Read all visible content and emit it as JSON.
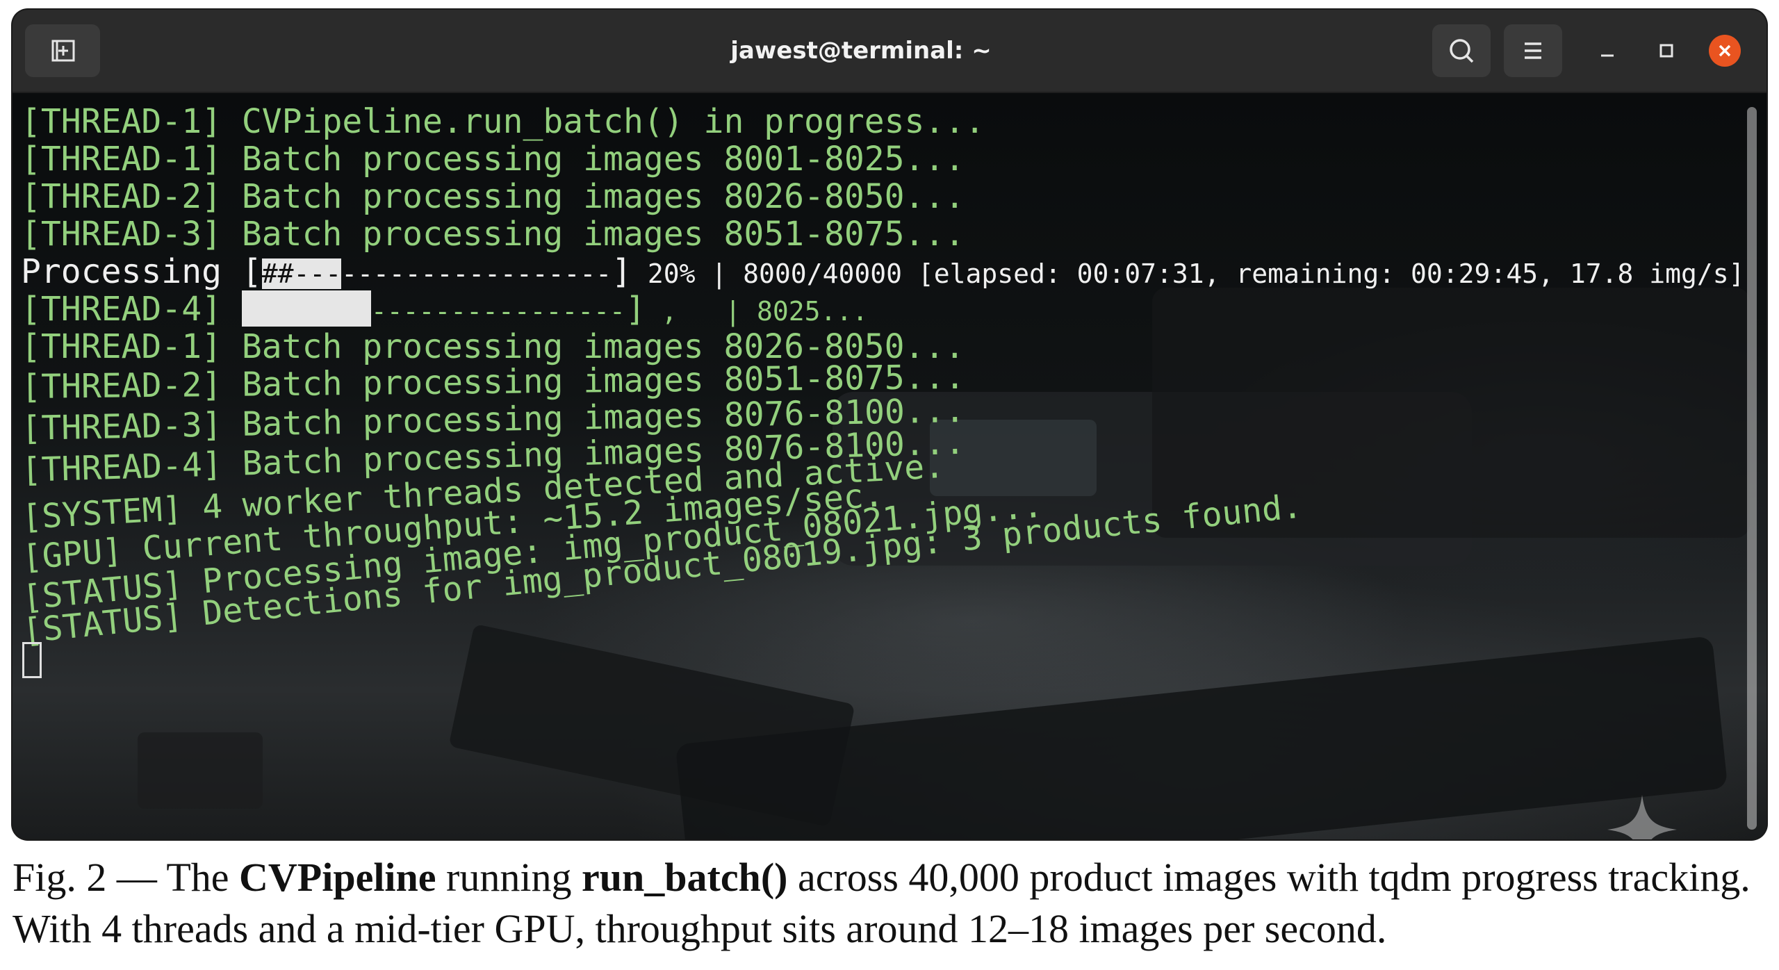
{
  "window": {
    "title": "jawest@terminal: ~",
    "close_color": "#e95420"
  },
  "icons": {
    "new_tab": "new-tab-icon",
    "search": "search-icon",
    "menu": "hamburger-menu-icon",
    "minimize": "minimize-icon",
    "maximize": "maximize-icon",
    "close": "close-icon"
  },
  "terminal": {
    "text_color": "#93d07d",
    "lines": [
      "[THREAD-1] CVPipeline.run_batch() in progress...",
      "[THREAD-1] Batch processing images 8001-8025...",
      "[THREAD-2] Batch processing images 8026-8050...",
      "[THREAD-3] Batch processing images 8051-8075..."
    ],
    "progress": {
      "label": "Processing ",
      "bar_open": "[",
      "bar_filled": "##---",
      "bar_rest": "-----------------",
      "bar_close": "]",
      "stats": " 20% | 8000/40000 [elapsed: 00:07:31, remaining: 00:29:45, 17.8 img/s]",
      "percent": 20
    },
    "thread4_line": {
      "prefix": "[THREAD-4] ",
      "bar_rest": "----------------",
      "bar_close": "]",
      "tail": " ,   | 8025..."
    },
    "lines_after": [
      "[THREAD-1] Batch processing images 8026-8050...",
      "[THREAD-2] Batch processing images 8051-8075...",
      "[THREAD-3] Batch processing images 8076-8100...",
      "[THREAD-4] Batch processing images 8076-8100...",
      "[SYSTEM] 4 worker threads detected and active.",
      "[GPU] Current throughput: ~15.2 images/sec.",
      "[STATUS] Processing image: img_product_08021.jpg...",
      "[STATUS] Detections for img_product_08019.jpg: 3 products found."
    ]
  },
  "caption": {
    "p1": "Fig. 2 — The ",
    "b1": "CVPipeline",
    "p2": " running ",
    "b2": "run_batch()",
    "p3": " across 40,000 product images with tqdm progress tracking. With 4 threads and a mid-tier GPU, throughput sits around 12–18 images per second."
  }
}
